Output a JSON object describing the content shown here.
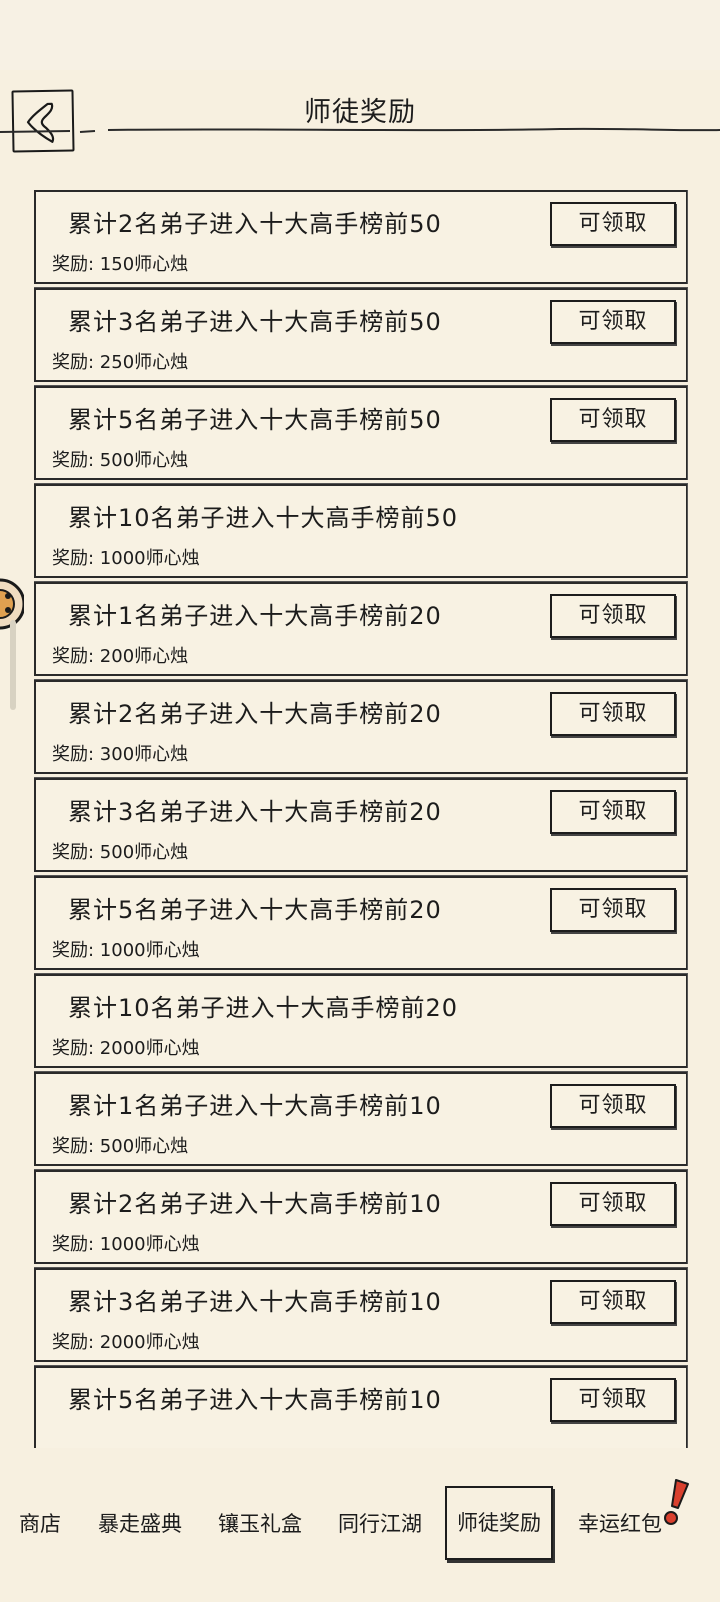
{
  "header": {
    "title": "师徒奖励"
  },
  "items": [
    {
      "title": "累计2名弟子进入十大高手榜前50",
      "reward": "奖励: 150师心烛",
      "button": "可领取"
    },
    {
      "title": "累计3名弟子进入十大高手榜前50",
      "reward": "奖励: 250师心烛",
      "button": "可领取"
    },
    {
      "title": "累计5名弟子进入十大高手榜前50",
      "reward": "奖励: 500师心烛",
      "button": "可领取"
    },
    {
      "title": "累计10名弟子进入十大高手榜前50",
      "reward": "奖励: 1000师心烛",
      "button": ""
    },
    {
      "title": "累计1名弟子进入十大高手榜前20",
      "reward": "奖励: 200师心烛",
      "button": "可领取"
    },
    {
      "title": "累计2名弟子进入十大高手榜前20",
      "reward": "奖励: 300师心烛",
      "button": "可领取"
    },
    {
      "title": "累计3名弟子进入十大高手榜前20",
      "reward": "奖励: 500师心烛",
      "button": "可领取"
    },
    {
      "title": "累计5名弟子进入十大高手榜前20",
      "reward": "奖励: 1000师心烛",
      "button": "可领取"
    },
    {
      "title": "累计10名弟子进入十大高手榜前20",
      "reward": "奖励: 2000师心烛",
      "button": ""
    },
    {
      "title": "累计1名弟子进入十大高手榜前10",
      "reward": "奖励: 500师心烛",
      "button": "可领取"
    },
    {
      "title": "累计2名弟子进入十大高手榜前10",
      "reward": "奖励: 1000师心烛",
      "button": "可领取"
    },
    {
      "title": "累计3名弟子进入十大高手榜前10",
      "reward": "奖励: 2000师心烛",
      "button": "可领取"
    },
    {
      "title": "累计5名弟子进入十大高手榜前10",
      "reward": "",
      "button": "可领取"
    }
  ],
  "tabs": [
    {
      "label": "商店",
      "active": false
    },
    {
      "label": "暴走盛典",
      "active": false
    },
    {
      "label": "镶玉礼盒",
      "active": false
    },
    {
      "label": "同行江湖",
      "active": false
    },
    {
      "label": "师徒奖励",
      "active": true
    },
    {
      "label": "幸运红包",
      "active": false
    }
  ],
  "icons": {
    "back": "back-chevron-icon",
    "float": "mascot-icon",
    "badge": "exclamation-badge-icon"
  },
  "colors": {
    "background": "#f7f0e0",
    "ink": "#1c1c1c",
    "badge_red": "#d9402e"
  }
}
